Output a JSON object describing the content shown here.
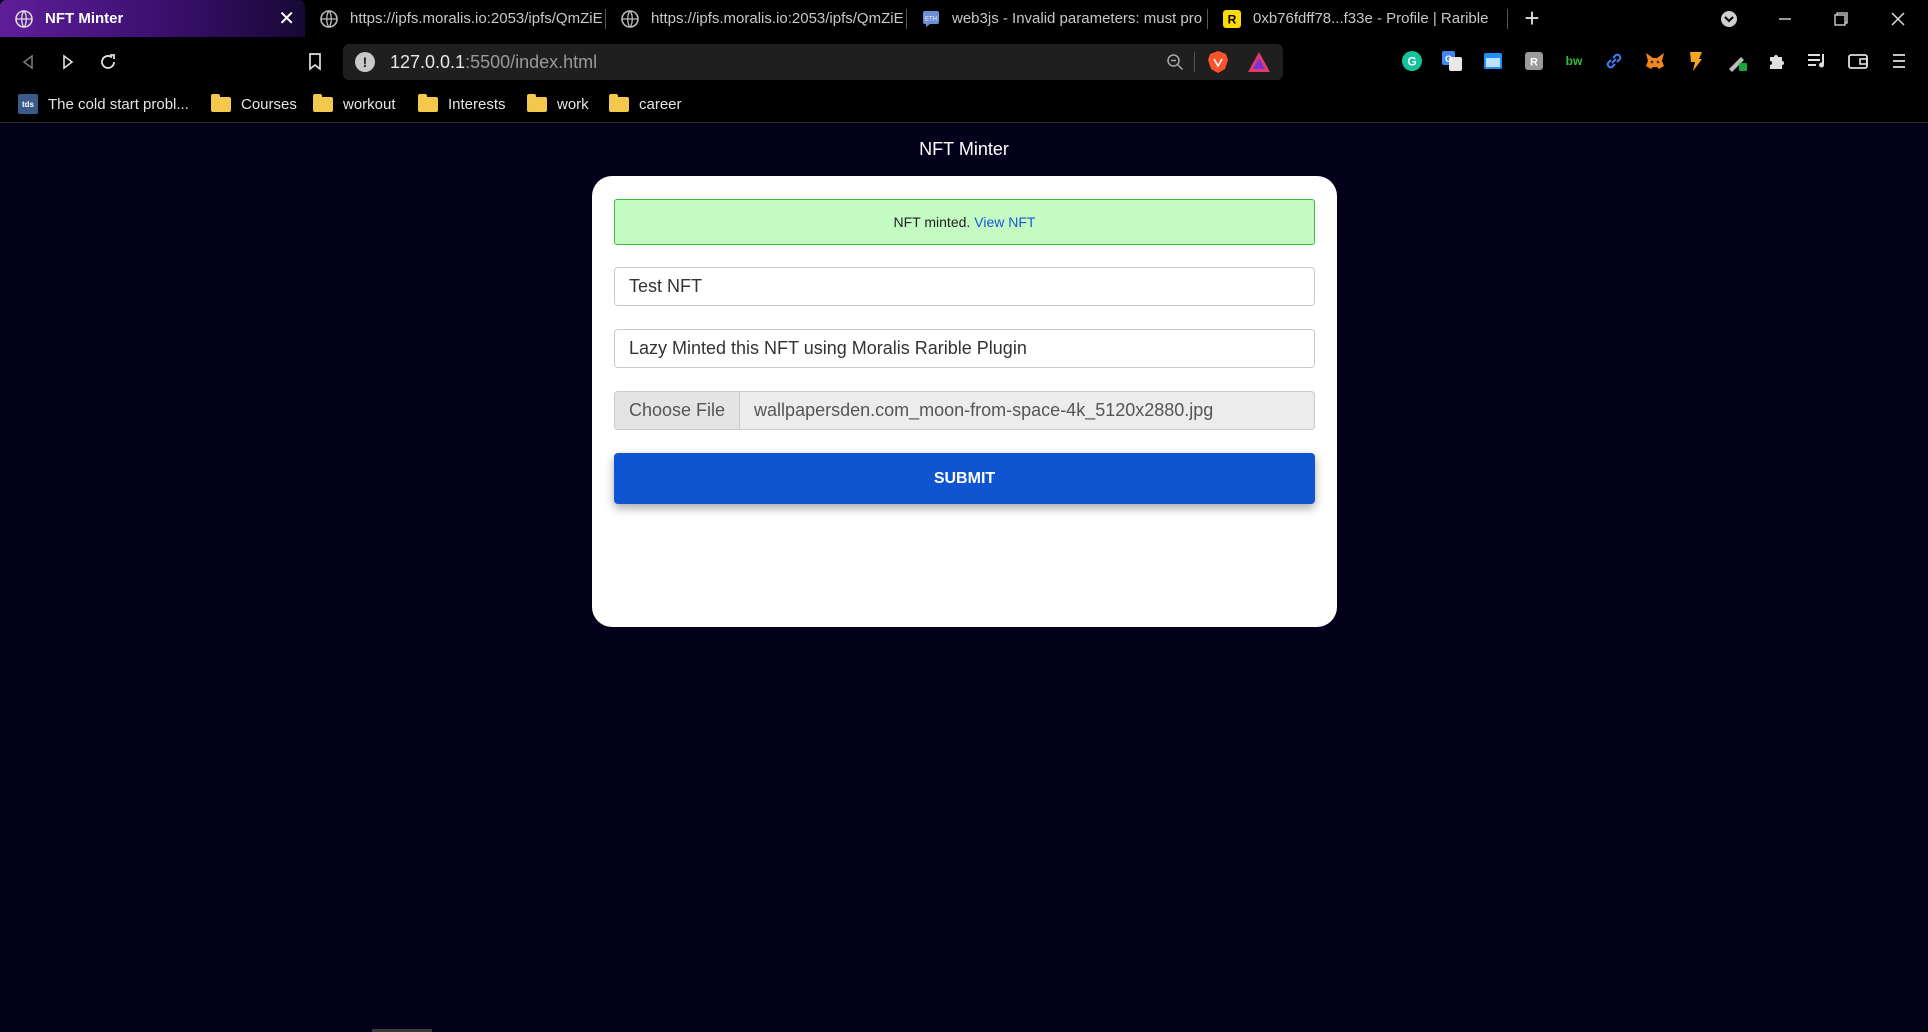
{
  "browser": {
    "tabs": [
      {
        "title": "NFT Minter",
        "active": true,
        "icon": "globe-icon"
      },
      {
        "title": "https://ipfs.moralis.io:2053/ipfs/QmZiE",
        "active": false,
        "icon": "globe-icon"
      },
      {
        "title": "https://ipfs.moralis.io:2053/ipfs/QmZiE",
        "active": false,
        "icon": "globe-icon"
      },
      {
        "title": "web3js - Invalid parameters: must pro",
        "active": false,
        "icon": "eth-stackexchange-icon"
      },
      {
        "title": "0xb76fdff78...f33e - Profile | Rarible",
        "active": false,
        "icon": "rarible-icon"
      }
    ],
    "address": {
      "host": "127.0.0.1",
      "path": ":5500/index.html"
    },
    "bookmarks": [
      {
        "label": "The cold start probl...",
        "icon": "tds-icon"
      },
      {
        "label": "Courses",
        "icon": "folder-icon"
      },
      {
        "label": "workout",
        "icon": "folder-icon"
      },
      {
        "label": "Interests",
        "icon": "folder-icon"
      },
      {
        "label": "work",
        "icon": "folder-icon"
      },
      {
        "label": "career",
        "icon": "folder-icon"
      }
    ],
    "extensions": {
      "bw_label": "bw"
    },
    "colors": {
      "active_tab": "#5f1e9a",
      "page_bg": "#03001a"
    }
  },
  "page": {
    "title": "NFT Minter",
    "alert": {
      "text": "NFT minted.",
      "link": "View NFT"
    },
    "name_value": "Test NFT",
    "description_value": "Lazy Minted this NFT using Moralis Rarible Plugin",
    "file": {
      "button": "Choose File",
      "filename": "wallpapersden.com_moon-from-space-4k_5120x2880.jpg"
    },
    "submit_label": "SUBMIT",
    "colors": {
      "alert_bg": "#c3fbc3",
      "alert_border": "#3bbf3b",
      "submit": "#0f54d1",
      "link": "#1a56d6"
    }
  }
}
